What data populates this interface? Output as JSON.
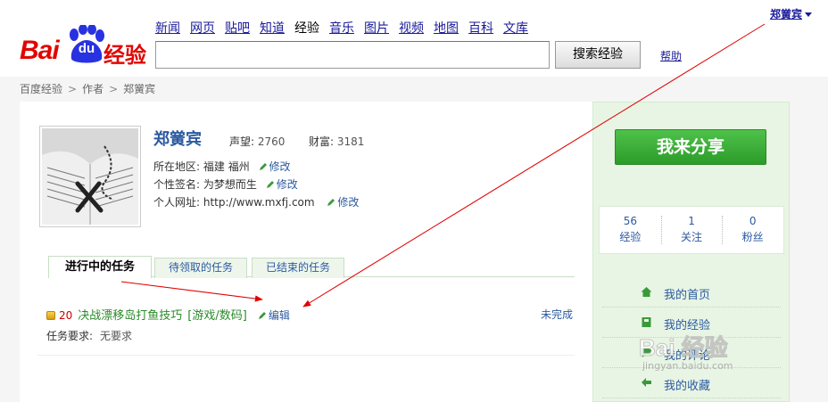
{
  "header": {
    "logo_text": "Bai",
    "logo_du": "du",
    "logo_suffix": "经验",
    "nav": [
      "新闻",
      "网页",
      "贴吧",
      "知道",
      "经验",
      "音乐",
      "图片",
      "视频",
      "地图",
      "百科",
      "文库"
    ],
    "nav_current": "经验",
    "search_value": "",
    "search_button": "搜索经验",
    "help": "帮助",
    "user_name": "郑黉宾"
  },
  "breadcrumb": [
    "百度经验",
    "作者",
    "郑黉宾"
  ],
  "profile": {
    "name": "郑黉宾",
    "reputation_label": "声望:",
    "reputation_value": "2760",
    "wealth_label": "财富:",
    "wealth_value": "3181",
    "location_label": "所在地区:",
    "location_value": "福建 福州",
    "signature_label": "个性签名:",
    "signature_value": "为梦想而生",
    "website_label": "个人网址:",
    "website_value": "http://www.mxfj.com",
    "edit_label": "修改"
  },
  "tabs": [
    "进行中的任务",
    "待领取的任务",
    "已结束的任务"
  ],
  "task": {
    "points": "20",
    "title": "决战漂移岛打鱼技巧",
    "category": "[游戏/数码]",
    "edit": "编辑",
    "status": "未完成",
    "requirement_label": "任务要求:",
    "requirement_value": "无要求"
  },
  "sidebar": {
    "share_button": "我来分享",
    "stats": [
      {
        "number": "56",
        "label": "经验"
      },
      {
        "number": "1",
        "label": "关注"
      },
      {
        "number": "0",
        "label": "粉丝"
      }
    ],
    "nav": [
      {
        "label": "我的首页",
        "icon": "home-icon"
      },
      {
        "label": "我的经验",
        "icon": "book-icon"
      },
      {
        "label": "我的评论",
        "icon": "comment-icon"
      },
      {
        "label": "我的收藏",
        "icon": "bookmark-icon"
      }
    ]
  },
  "watermark": {
    "text": "Bai 经验",
    "url": "jingyan.baidu.com"
  },
  "colors": {
    "brand_red": "#e10601",
    "link_blue": "#2c5aa0",
    "task_green": "#2a8a2a",
    "share_green": "#3bb138",
    "sidebar_bg": "#e8f5e4",
    "annotation_red": "#e00000"
  }
}
